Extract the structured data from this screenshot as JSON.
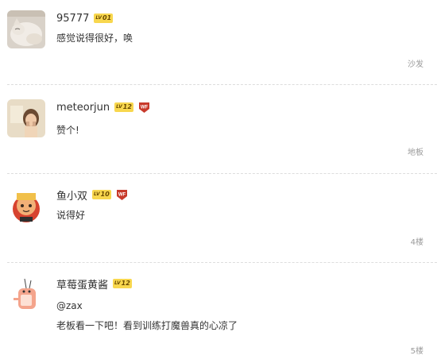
{
  "comments": [
    {
      "username": "95777",
      "level_prefix": "LV",
      "level": "01",
      "has_wf_badge": false,
      "content": [
        "感觉说得很好，唤"
      ],
      "floor": "沙发",
      "avatar": "cat-avatar"
    },
    {
      "username": "meteorjun",
      "level_prefix": "LV",
      "level": "12",
      "has_wf_badge": true,
      "badge_text": "WF",
      "content": [
        "赞个!"
      ],
      "floor": "地板",
      "avatar": "girl-avatar"
    },
    {
      "username": "鱼小双",
      "level_prefix": "LV",
      "level": "10",
      "has_wf_badge": true,
      "badge_text": "WF",
      "content": [
        "说得好"
      ],
      "floor": "4楼",
      "avatar": "cartoon-character-avatar"
    },
    {
      "username": "草莓蛋黄酱",
      "level_prefix": "LV",
      "level": "12",
      "has_wf_badge": false,
      "content": [
        "@zax",
        "老板看一下吧！看到训练打魔兽真的心凉了"
      ],
      "floor": "5楼",
      "avatar": "cartoon-figure-avatar"
    }
  ],
  "colors": {
    "level_badge": "#f8d74e",
    "wf_badge": "#c83a2b",
    "floor_text": "#9a9a9a",
    "divider": "#dddddd"
  }
}
